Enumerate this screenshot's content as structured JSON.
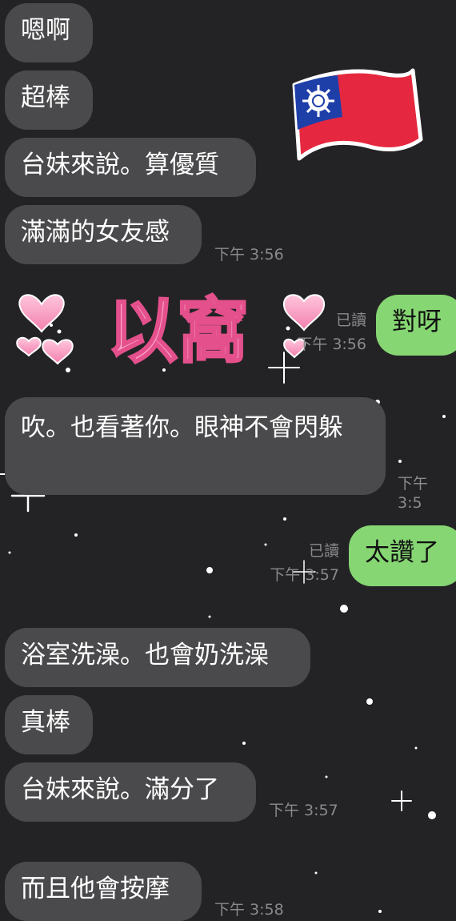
{
  "messages": [
    {
      "text": "嗯啊"
    },
    {
      "text": "超棒"
    },
    {
      "text": "台妹來說。算優質"
    },
    {
      "text": "滿滿的女友感",
      "time": "下午 3:56"
    },
    {
      "text": "對呀",
      "read": "已讀",
      "time": "下午 3:56"
    },
    {
      "text": "吹。也看著你。眼神不會閃躲",
      "time": "下午 3:5"
    },
    {
      "text": "太讚了",
      "read": "已讀",
      "time": "下午 3:57"
    },
    {
      "text": "浴室洗澡。也會奶洗澡"
    },
    {
      "text": "真棒"
    },
    {
      "text": "台妹來說。滿分了",
      "time": "下午 3:57"
    },
    {
      "text": "而且他會按摩",
      "time": "下午 3:58"
    }
  ],
  "stickers": {
    "heart_sticker_text": "以窩",
    "flag_sticker": "taiwan-flag-icon"
  },
  "colors": {
    "background": "#232325",
    "incoming_bubble": "#4a4a4c",
    "outgoing_bubble": "#86d673",
    "sticker_pink": "#f9a6c8"
  }
}
